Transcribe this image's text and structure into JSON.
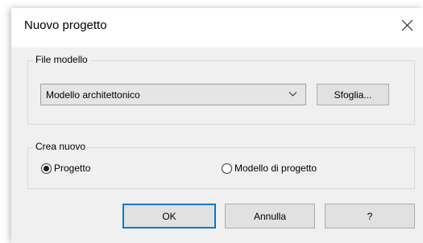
{
  "window": {
    "title": "Nuovo progetto"
  },
  "template_group": {
    "label": "File modello",
    "selected_template": "Modello architettonico",
    "browse_label": "Sfoglia..."
  },
  "create_group": {
    "label": "Crea nuovo",
    "options": [
      {
        "label": "Progetto",
        "selected": true
      },
      {
        "label": "Modello di progetto",
        "selected": false
      }
    ]
  },
  "footer": {
    "ok_label": "OK",
    "cancel_label": "Annulla",
    "help_label": "?"
  },
  "colors": {
    "accent": "#0078d7",
    "dialog_bg": "#f0f0f0"
  },
  "icons": {
    "close": "close-icon",
    "dropdown": "chevron-down-icon"
  }
}
